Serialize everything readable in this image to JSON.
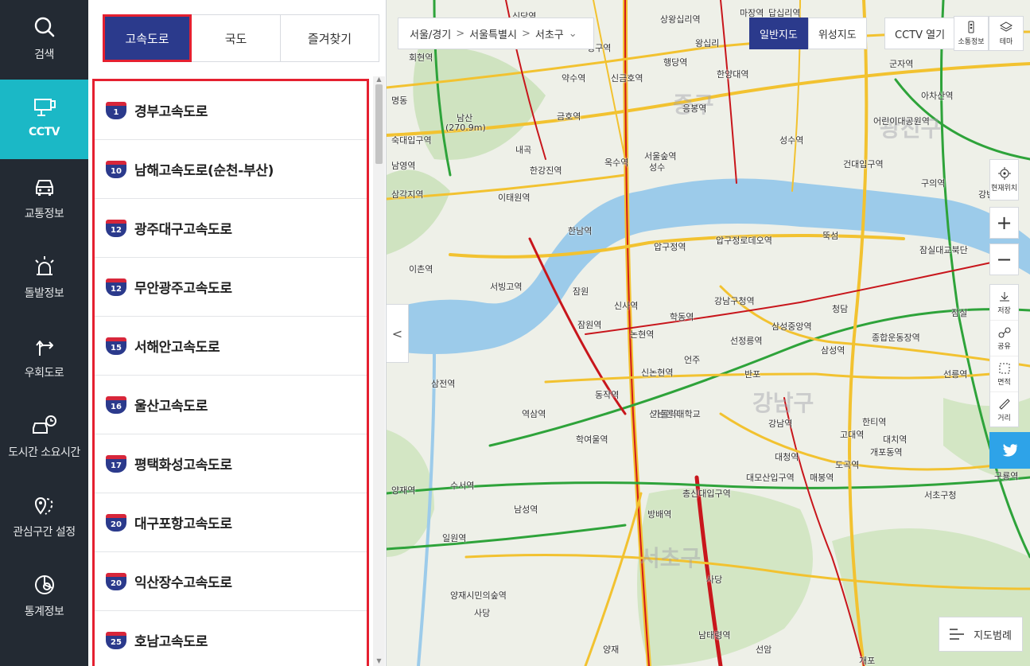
{
  "sidebar": {
    "items": [
      {
        "label": "검색",
        "icon": "search-icon"
      },
      {
        "label": "CCTV",
        "icon": "cctv-icon"
      },
      {
        "label": "교통정보",
        "icon": "car-icon"
      },
      {
        "label": "돌발정보",
        "icon": "alert-light-icon"
      },
      {
        "label": "우회도로",
        "icon": "detour-icon"
      },
      {
        "label": "도시간 소요시간",
        "icon": "car-clock-icon"
      },
      {
        "label": "관심구간 설정",
        "icon": "pin-route-icon"
      },
      {
        "label": "통계정보",
        "icon": "chart-pie-icon"
      }
    ]
  },
  "panel": {
    "tabs": [
      {
        "label": "고속도로"
      },
      {
        "label": "국도"
      },
      {
        "label": "즐겨찾기"
      }
    ],
    "highways": [
      {
        "num": "1",
        "name": "경부고속도로"
      },
      {
        "num": "10",
        "name": "남해고속도로(순천-부산)"
      },
      {
        "num": "12",
        "name": "광주대구고속도로"
      },
      {
        "num": "12",
        "name": "무안광주고속도로"
      },
      {
        "num": "15",
        "name": "서해안고속도로"
      },
      {
        "num": "16",
        "name": "울산고속도로"
      },
      {
        "num": "17",
        "name": "평택화성고속도로"
      },
      {
        "num": "20",
        "name": "대구포항고속도로"
      },
      {
        "num": "20",
        "name": "익산장수고속도로"
      },
      {
        "num": "25",
        "name": "호남고속도로"
      }
    ]
  },
  "map": {
    "breadcrumb": [
      "서울/경기",
      "서울특별시",
      "서초구"
    ],
    "map_types": [
      "일반지도",
      "위성지도"
    ],
    "cctv_open": "CCTV 열기",
    "btn_traffic": "소통정보",
    "btn_theme": "테마",
    "btn_location": "현재위치",
    "tools": [
      "저장",
      "공유",
      "면적",
      "거리"
    ],
    "legend": "지도범례",
    "districts": [
      "중구",
      "광진구",
      "강남구",
      "서초구"
    ],
    "labels": [
      "신당역",
      "상왕십리역",
      "마장역",
      "답십리역",
      "왕십리",
      "군자역",
      "청구역",
      "행당역",
      "회현역",
      "약수역",
      "신금호역",
      "한양대역",
      "아차산역",
      "명동",
      "남산",
      "(270.9m)",
      "금호역",
      "응봉역",
      "어린이대공원역",
      "숙대입구역",
      "옥수역",
      "서울숲역",
      "성수역",
      "남영역",
      "한강진역",
      "성수",
      "건대입구역",
      "삼각지역",
      "이태원역",
      "구의역",
      "강변역",
      "한남역",
      "압구정역",
      "압구정로데오역",
      "뚝섬",
      "잠실대교북단",
      "이촌역",
      "서빙고역",
      "잠원",
      "신사역",
      "강남구청역",
      "청담",
      "잠실",
      "잠원역",
      "논현역",
      "학동역",
      "삼성중앙역",
      "종합운동장역",
      "신논현역",
      "언주",
      "선정릉역",
      "삼성역",
      "선릉역",
      "삼전역",
      "동작역",
      "반포",
      "신논현역",
      "역삼역",
      "가톨릭대학교",
      "강남역",
      "한티역",
      "학여울역",
      "고대역",
      "대치역",
      "대청역",
      "도곡역",
      "개포동역",
      "대모산입구역",
      "매봉역",
      "구룡역",
      "수서역",
      "총신대입구역",
      "양재역",
      "남성역",
      "방배역",
      "서초구청",
      "일원역",
      "사당",
      "양재시민의숲역",
      "사당",
      "남태령역",
      "양재",
      "선암",
      "개포",
      "내곡"
    ]
  }
}
